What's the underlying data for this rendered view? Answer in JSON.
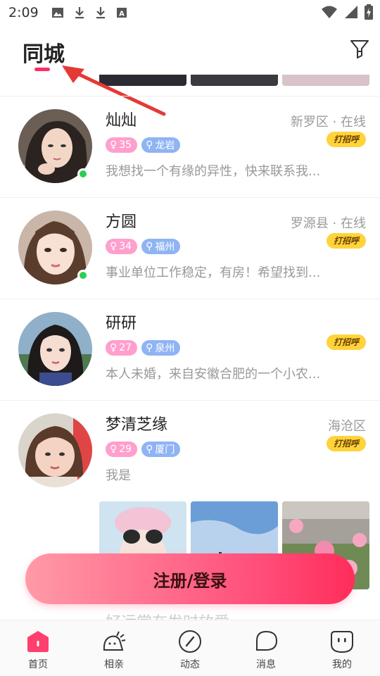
{
  "status_bar": {
    "time": "2:09",
    "icons": [
      "image-icon",
      "download-icon",
      "download-icon",
      "a-icon"
    ],
    "right_icons": [
      "wifi-icon",
      "signal-icon",
      "battery-icon"
    ]
  },
  "header": {
    "title": "同城",
    "accent_color": "#ff2b66",
    "filter_icon": "filter-icon"
  },
  "profiles": [
    {
      "name": "灿灿",
      "location": "新罗区 · 在线",
      "greet": "打招呼",
      "age": "35",
      "city": "龙岩",
      "bio": "我想找一个有缘的异性，快来联系我...",
      "online": true
    },
    {
      "name": "方圆",
      "location": "罗源县 · 在线",
      "greet": "打招呼",
      "age": "34",
      "city": "福州",
      "bio": "事业单位工作稳定，有房！希望找到...",
      "online": true
    },
    {
      "name": "研研",
      "location": "",
      "greet": "打招呼",
      "age": "27",
      "city": "泉州",
      "bio": "本人未婚，来自安徽合肥的一个小农...",
      "online": false
    },
    {
      "name": "梦清芝缘",
      "location": "海沧区",
      "greet": "打招呼",
      "age": "29",
      "city": "厦门",
      "bio": "我是",
      "online": false
    }
  ],
  "register_button": "注册/登录",
  "faded_text": "好运常在发时放爱",
  "tabs": [
    {
      "label": "首页",
      "icon": "home-icon",
      "active": true
    },
    {
      "label": "相亲",
      "icon": "match-icon",
      "active": false
    },
    {
      "label": "动态",
      "icon": "compass-icon",
      "active": false
    },
    {
      "label": "消息",
      "icon": "message-icon",
      "active": false
    },
    {
      "label": "我的",
      "icon": "profile-icon",
      "active": false
    }
  ],
  "colors": {
    "online": "#2ecc55",
    "greet": "#ffd43b",
    "age_tag": "#ff9fcd",
    "city_tag": "#8fb4f4",
    "annotation_arrow": "#e53935"
  }
}
